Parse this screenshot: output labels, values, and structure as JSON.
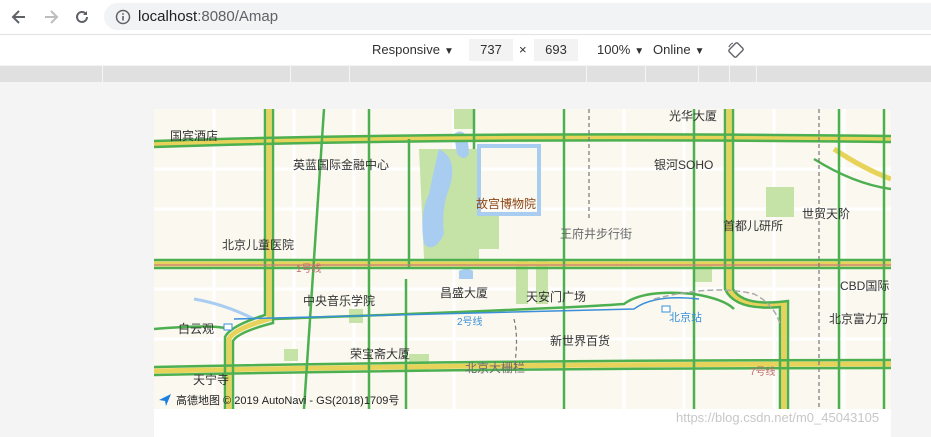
{
  "browser": {
    "url_host": "localhost",
    "url_port": ":8080",
    "url_path": "/Amap"
  },
  "devtools": {
    "device": "Responsive",
    "width": "737",
    "height": "693",
    "times": "×",
    "zoom": "100%",
    "network": "Online"
  },
  "map": {
    "labels": {
      "guobin": "国宾酒店",
      "yinglan": "英蓝国际金融中心",
      "gugong": "故宫博物院",
      "yinhe": "银河SOHO",
      "wangfujing": "王府井步行街",
      "shoudu": "首都儿研所",
      "shimao": "世贸天阶",
      "ertong": "北京儿童医院",
      "line1": "1号线",
      "zhongyang": "中央音乐学院",
      "changsheng": "昌盛大厦",
      "tiananmen": "天安门广场",
      "cbd": "CBD国际",
      "baiyunguan": "白云观",
      "line2": "2号线",
      "beijingzhan": "北京站",
      "fuli": "北京富力万",
      "xinshijie": "新世界百货",
      "rongbao": "荣宝斋大厦",
      "dashilan": "北京大栅栏",
      "tianning": "天宁寺",
      "line7": "7号线",
      "guanghua": "光华大厦"
    },
    "copyright": "高德地图 © 2019 AutoNavi - GS(2018)1709号"
  },
  "watermark": "https://blog.csdn.net/m0_45043105",
  "colors": {
    "road_green": "#4caf50",
    "road_yellow": "#e8d35a",
    "park_green": "#c5e3a7",
    "water_blue": "#a8cdf0",
    "metro_blue": "#3a8fd8"
  }
}
